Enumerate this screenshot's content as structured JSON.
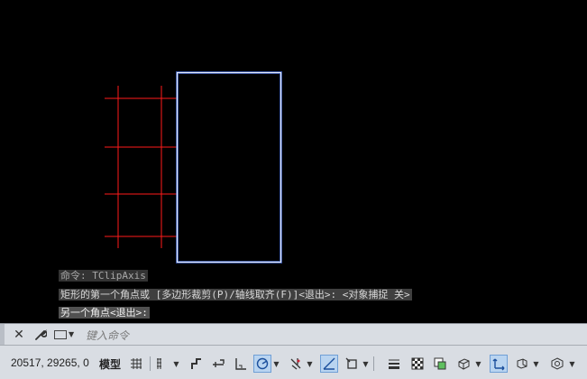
{
  "command_history": [
    "命令: TClipAxis",
    "矩形的第一个角点或 [多边形裁剪(P)/轴线取齐(F)]<退出>: <对象捕捉 关>",
    "另一个角点<退出>:"
  ],
  "command_line": {
    "placeholder": "键入命令",
    "close_icon": "close-icon",
    "customize_icon": "wrench-icon",
    "recent_icon": "recent-commands-icon"
  },
  "status_bar": {
    "coordinates": "20517, 29265, 0",
    "model_label": "模型",
    "buttons": [
      {
        "name": "grid-icon",
        "active": false
      },
      {
        "name": "snap-icon",
        "active": false
      },
      {
        "name": "infer-constraints-icon",
        "active": false
      },
      {
        "name": "dynamic-input-icon",
        "active": false
      },
      {
        "name": "ortho-icon",
        "active": false
      },
      {
        "name": "polar-tracking-icon",
        "active": true
      },
      {
        "name": "isometric-drafting-icon",
        "active": false
      },
      {
        "name": "object-snap-tracking-icon",
        "active": true
      },
      {
        "name": "object-snap-icon",
        "active": false
      },
      {
        "name": "lineweight-icon",
        "active": false
      },
      {
        "name": "transparency-icon",
        "active": false
      },
      {
        "name": "selection-cycling-icon",
        "active": false
      },
      {
        "name": "3d-object-snap-icon",
        "active": false
      },
      {
        "name": "dynamic-ucs-icon",
        "active": true
      },
      {
        "name": "selection-filtering-icon",
        "active": false
      },
      {
        "name": "gizmo-icon",
        "active": false
      }
    ]
  },
  "drawing": {
    "axis_color": "#ff1a1a",
    "rectangle_color": "#dfe8ff",
    "rectangle_glow": "#4d79ff",
    "background": "#000000"
  }
}
